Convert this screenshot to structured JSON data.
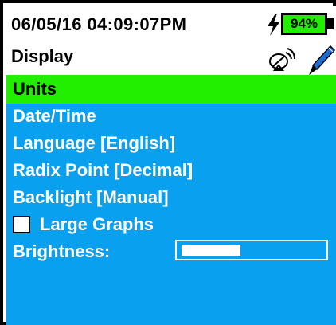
{
  "status_bar": {
    "datetime": "06/05/16  04:09:07PM",
    "battery_percent": "94%",
    "charging_icon": "lightning-bolt",
    "colors": {
      "battery_fill": "#22ee00"
    }
  },
  "header": {
    "title": "Display",
    "icons": [
      "satellite-icon",
      "pen-icon"
    ]
  },
  "menu": {
    "items": [
      {
        "label": "Units",
        "selected": true
      },
      {
        "label": "Date/Time"
      },
      {
        "label": "Language [English]"
      },
      {
        "label": "Radix Point [Decimal]"
      },
      {
        "label": "Backlight [Manual]"
      }
    ],
    "large_graphs": {
      "label": "Large Graphs",
      "checked": false
    },
    "brightness": {
      "label": "Brightness:",
      "level": 0.42
    }
  },
  "colors": {
    "panel_bg": "#0aa0f0",
    "selected_bg": "#22ee00",
    "text": "#ffffff"
  }
}
